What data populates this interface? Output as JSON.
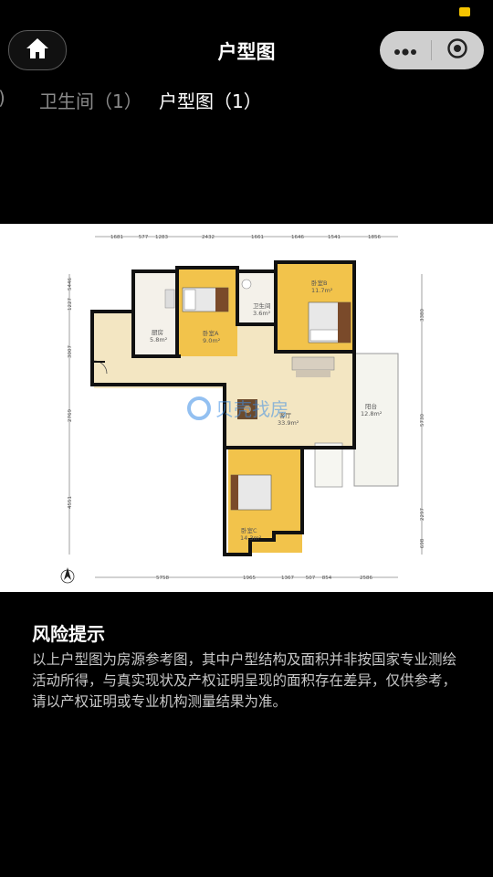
{
  "header": {
    "title": "户型图"
  },
  "tabs": [
    {
      "label": ")"
    },
    {
      "label": "卫生间（1）"
    },
    {
      "label": "户型图（1）"
    }
  ],
  "floorplan": {
    "dims_top": [
      "1681",
      "577",
      "1283",
      "2432",
      "1661",
      "1646",
      "1541",
      "1856"
    ],
    "dims_bottom": [
      "5758",
      "1965",
      "1367",
      "507",
      "854",
      "2586"
    ],
    "dims_left": [
      "5446",
      "1227",
      "3007",
      "2769",
      "4551"
    ],
    "dims_right": [
      "3380",
      "5730",
      "2297",
      "698"
    ],
    "rooms": [
      {
        "name": "厨房",
        "area": "5.8m²"
      },
      {
        "name": "卧室A",
        "area": "9.0m²"
      },
      {
        "name": "卫生间",
        "area": "3.6m²"
      },
      {
        "name": "卧室B",
        "area": "11.7m²"
      },
      {
        "name": "客厅",
        "area": "33.9m²"
      },
      {
        "name": "阳台",
        "area": "12.8m²"
      },
      {
        "name": "卧室C",
        "area": "14.3m²"
      }
    ],
    "watermark": "贝壳找房"
  },
  "risk": {
    "title": "风险提示",
    "body": "以上户型图为房源参考图，其中户型结构及面积并非按国家专业测绘活动所得，与真实现状及产权证明呈现的面积存在差异，仅供参考，请以产权证明或专业机构测量结果为准。"
  },
  "colors": {
    "accent_status": "#f5c400",
    "capsule_bg": "#cfcfcf",
    "floor_wood": "#f2c34b",
    "floor_tile": "#f3e6c2",
    "wall": "#111111"
  }
}
